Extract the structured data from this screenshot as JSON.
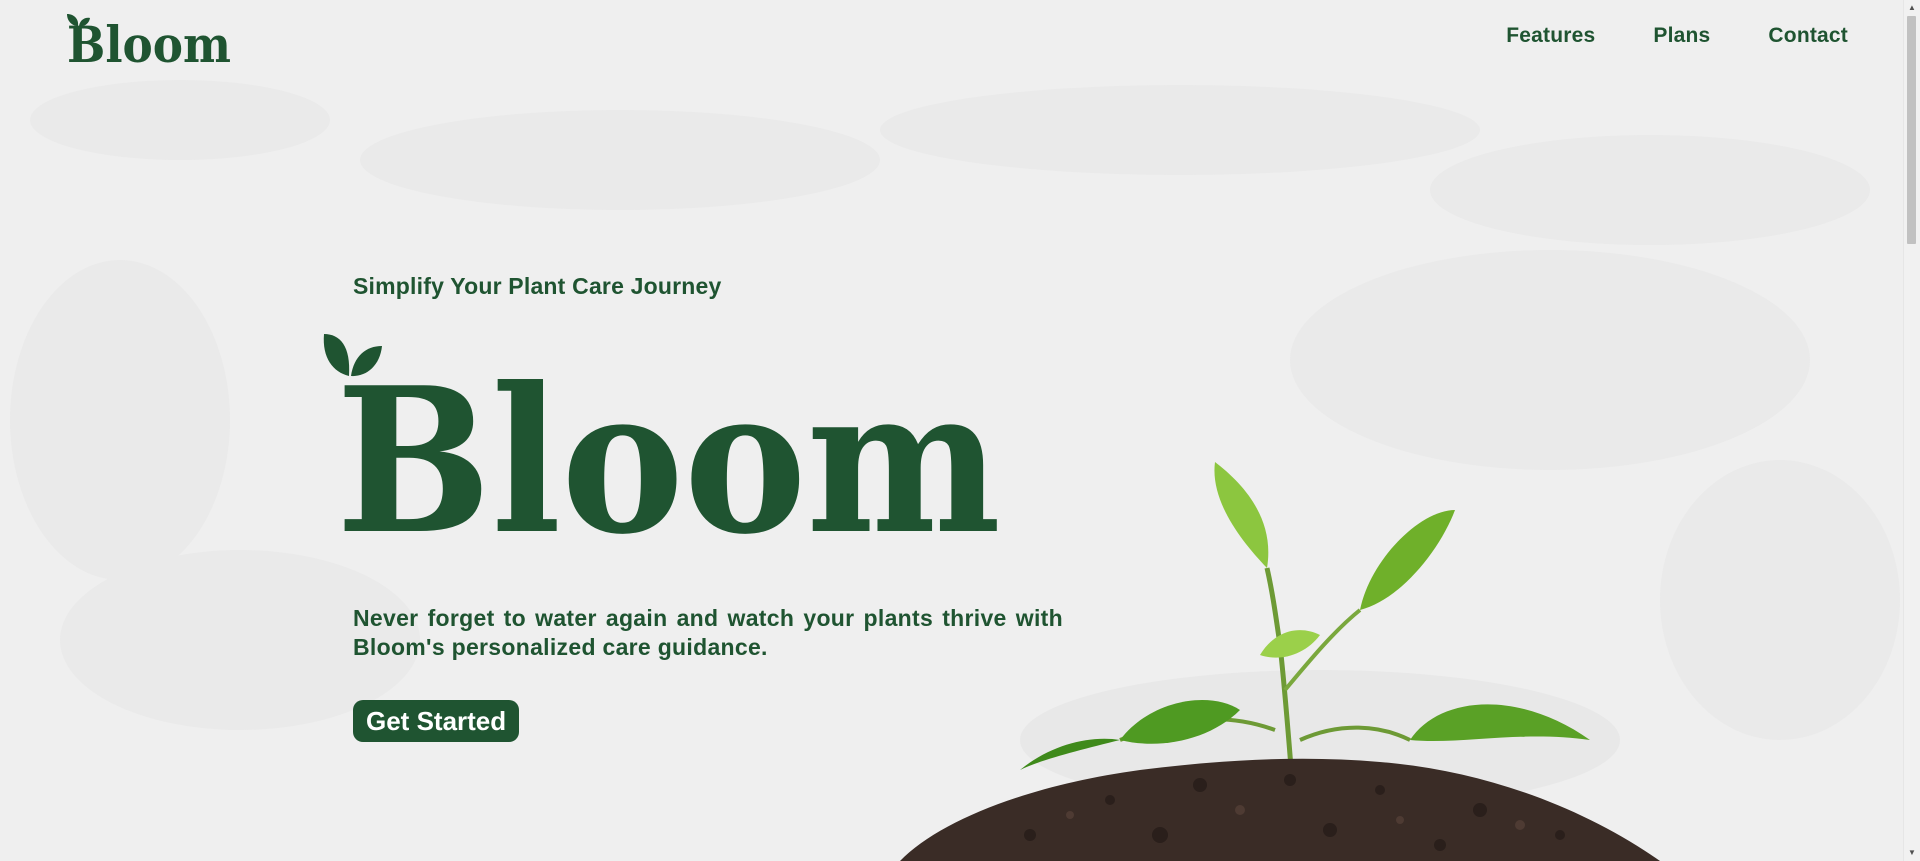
{
  "brand": {
    "logo_text": "Bloom"
  },
  "nav": {
    "items": [
      {
        "label": "Features"
      },
      {
        "label": "Plans"
      },
      {
        "label": "Contact"
      }
    ]
  },
  "hero": {
    "tagline": "Simplify Your Plant Care Journey",
    "logo_text": "Bloom",
    "description": "Never forget to water again and watch your plants thrive with Bloom's personalized care guidance.",
    "cta_label": "Get Started"
  },
  "colors": {
    "brand_green": "#1f5431",
    "background": "#efefef",
    "button_text": "#ffffff"
  },
  "icons": {
    "sprout": "sprout-leaves-icon",
    "scroll_up": "scroll-up-arrow-icon",
    "scroll_down": "scroll-down-arrow-icon"
  }
}
